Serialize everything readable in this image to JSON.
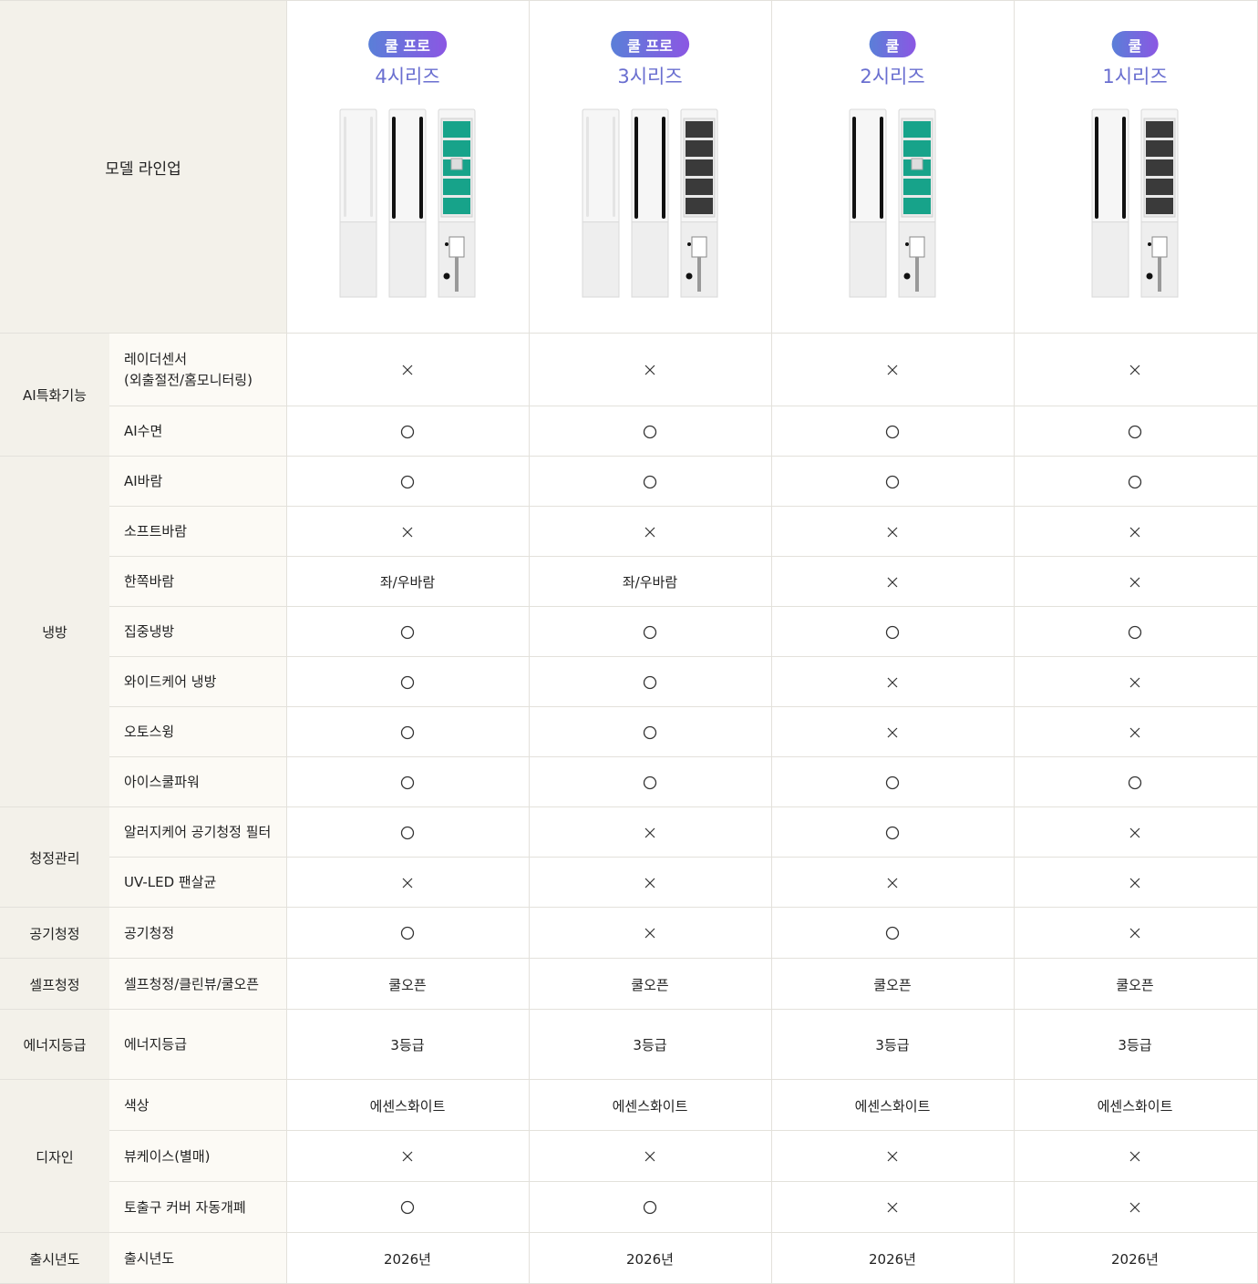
{
  "header": {
    "title": "모델 라인업"
  },
  "models": [
    {
      "badge": "쿨 프로",
      "series": "4시리즈",
      "panels": [
        "blank",
        "black",
        "filter-green"
      ]
    },
    {
      "badge": "쿨 프로",
      "series": "3시리즈",
      "panels": [
        "blank",
        "black",
        "filter-gray"
      ]
    },
    {
      "badge": "쿨",
      "series": "2시리즈",
      "panels": [
        "black",
        "filter-green"
      ]
    },
    {
      "badge": "쿨",
      "series": "1시리즈",
      "panels": [
        "black",
        "filter-gray"
      ]
    }
  ],
  "groups": [
    {
      "category": "AI특화기능",
      "rows": [
        {
          "feature": "레이더센서\n(외출절전/홈모니터링)",
          "values": [
            "X",
            "X",
            "X",
            "X"
          ]
        },
        {
          "feature": "AI수면",
          "values": [
            "O",
            "O",
            "O",
            "O"
          ]
        }
      ]
    },
    {
      "category": "냉방",
      "rows": [
        {
          "feature": "AI바람",
          "values": [
            "O",
            "O",
            "O",
            "O"
          ]
        },
        {
          "feature": "소프트바람",
          "values": [
            "X",
            "X",
            "X",
            "X"
          ]
        },
        {
          "feature": "한쪽바람",
          "values": [
            "좌/우바람",
            "좌/우바람",
            "X",
            "X"
          ]
        },
        {
          "feature": "집중냉방",
          "values": [
            "O",
            "O",
            "O",
            "O"
          ]
        },
        {
          "feature": "와이드케어 냉방",
          "values": [
            "O",
            "O",
            "X",
            "X"
          ]
        },
        {
          "feature": "오토스윙",
          "values": [
            "O",
            "O",
            "X",
            "X"
          ]
        },
        {
          "feature": "아이스쿨파워",
          "values": [
            "O",
            "O",
            "O",
            "O"
          ]
        }
      ]
    },
    {
      "category": "청정관리",
      "rows": [
        {
          "feature": "알러지케어 공기청정 필터",
          "values": [
            "O",
            "X",
            "O",
            "X"
          ]
        },
        {
          "feature": "UV-LED 팬살균",
          "values": [
            "X",
            "X",
            "X",
            "X"
          ]
        }
      ]
    },
    {
      "category": "공기청정",
      "rows": [
        {
          "feature": "공기청정",
          "values": [
            "O",
            "X",
            "O",
            "X"
          ]
        }
      ]
    },
    {
      "category": "셀프청정",
      "rows": [
        {
          "feature": "셀프청정/클린뷰/쿨오픈",
          "values": [
            "쿨오픈",
            "쿨오픈",
            "쿨오픈",
            "쿨오픈"
          ]
        }
      ]
    },
    {
      "category": "에너지등급",
      "rows": [
        {
          "feature": "에너지등급",
          "values": [
            "3등급",
            "3등급",
            "3등급",
            "3등급"
          ]
        }
      ]
    },
    {
      "category": "디자인",
      "rows": [
        {
          "feature": "색상",
          "values": [
            "에센스화이트",
            "에센스화이트",
            "에센스화이트",
            "에센스화이트"
          ]
        },
        {
          "feature": "뷰케이스(별매)",
          "values": [
            "X",
            "X",
            "X",
            "X"
          ]
        },
        {
          "feature": "토출구 커버 자동개폐",
          "values": [
            "O",
            "O",
            "X",
            "X"
          ]
        }
      ]
    },
    {
      "category": "출시년도",
      "rows": [
        {
          "feature": "출시년도",
          "values": [
            "2026년",
            "2026년",
            "2026년",
            "2026년"
          ]
        }
      ]
    }
  ]
}
